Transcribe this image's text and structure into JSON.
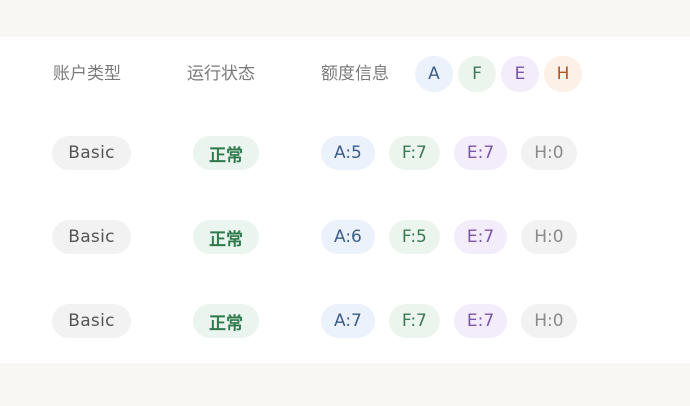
{
  "header": {
    "account_type": "账户类型",
    "status": "运行状态",
    "quota": "额度信息"
  },
  "legend": [
    {
      "label": "A",
      "color": "#3d5d8a",
      "bg": "#ebf2fc"
    },
    {
      "label": "F",
      "color": "#3b7a55",
      "bg": "#ebf5ee"
    },
    {
      "label": "E",
      "color": "#7b55a8",
      "bg": "#f3ecfb"
    },
    {
      "label": "H",
      "color": "#b4551c",
      "bg": "#fdf0e6"
    }
  ],
  "rows": [
    {
      "type": "Basic",
      "status": "正常",
      "quota": [
        "A:5",
        "F:7",
        "E:7",
        "H:0"
      ]
    },
    {
      "type": "Basic",
      "status": "正常",
      "quota": [
        "A:6",
        "F:5",
        "E:7",
        "H:0"
      ]
    },
    {
      "type": "Basic",
      "status": "正常",
      "quota": [
        "A:7",
        "F:7",
        "E:7",
        "H:0"
      ]
    }
  ]
}
